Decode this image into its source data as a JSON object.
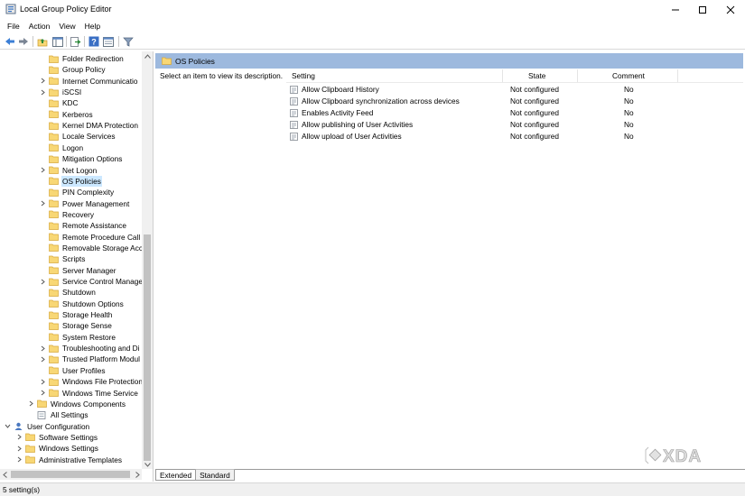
{
  "window": {
    "title": "Local Group Policy Editor",
    "app_icon": "policy-editor-icon",
    "controls": [
      "minimize-icon",
      "maximize-icon",
      "close-icon"
    ]
  },
  "menu": [
    "File",
    "Action",
    "View",
    "Help"
  ],
  "toolbar": {
    "buttons": [
      "back-arrow-icon",
      "forward-arrow-icon",
      "up-folder-icon",
      "show-hide-tree-icon",
      "export-list-icon",
      "help-icon",
      "properties-view-icon",
      "filter-icon"
    ]
  },
  "tree": {
    "items": [
      {
        "label": "Folder Redirection",
        "expandable": false
      },
      {
        "label": "Group Policy",
        "expandable": false
      },
      {
        "label": "Internet Communicatio",
        "expandable": true
      },
      {
        "label": "iSCSI",
        "expandable": true
      },
      {
        "label": "KDC",
        "expandable": false
      },
      {
        "label": "Kerberos",
        "expandable": false
      },
      {
        "label": "Kernel DMA Protection",
        "expandable": false
      },
      {
        "label": "Locale Services",
        "expandable": false
      },
      {
        "label": "Logon",
        "expandable": false
      },
      {
        "label": "Mitigation Options",
        "expandable": false
      },
      {
        "label": "Net Logon",
        "expandable": true
      },
      {
        "label": "OS Policies",
        "expandable": false,
        "selected": true
      },
      {
        "label": "PIN Complexity",
        "expandable": false
      },
      {
        "label": "Power Management",
        "expandable": true
      },
      {
        "label": "Recovery",
        "expandable": false
      },
      {
        "label": "Remote Assistance",
        "expandable": false
      },
      {
        "label": "Remote Procedure Call",
        "expandable": false
      },
      {
        "label": "Removable Storage Acc",
        "expandable": false
      },
      {
        "label": "Scripts",
        "expandable": false
      },
      {
        "label": "Server Manager",
        "expandable": false
      },
      {
        "label": "Service Control Manage",
        "expandable": true
      },
      {
        "label": "Shutdown",
        "expandable": false
      },
      {
        "label": "Shutdown Options",
        "expandable": false
      },
      {
        "label": "Storage Health",
        "expandable": false
      },
      {
        "label": "Storage Sense",
        "expandable": false
      },
      {
        "label": "System Restore",
        "expandable": false
      },
      {
        "label": "Troubleshooting and Di",
        "expandable": true
      },
      {
        "label": "Trusted Platform Modul",
        "expandable": true
      },
      {
        "label": "User Profiles",
        "expandable": false
      },
      {
        "label": "Windows File Protection",
        "expandable": true
      },
      {
        "label": "Windows Time Service",
        "expandable": true
      },
      {
        "label": "Windows Components",
        "expandable": true
      },
      {
        "label": "All Settings",
        "expandable": false
      },
      {
        "label": "User Configuration",
        "expandable": true,
        "expanded": true
      },
      {
        "label": "Software Settings",
        "expandable": true
      },
      {
        "label": "Windows Settings",
        "expandable": true
      },
      {
        "label": "Administrative Templates",
        "expandable": true
      }
    ]
  },
  "right_pane": {
    "folder_title": "OS Policies",
    "description": "Select an item to view its description.",
    "columns": [
      "Setting",
      "State",
      "Comment"
    ],
    "rows": [
      {
        "setting": "Allow Clipboard History",
        "state": "Not configured",
        "comment": "No"
      },
      {
        "setting": "Allow Clipboard synchronization across devices",
        "state": "Not configured",
        "comment": "No"
      },
      {
        "setting": "Enables Activity Feed",
        "state": "Not configured",
        "comment": "No"
      },
      {
        "setting": "Allow publishing of User Activities",
        "state": "Not configured",
        "comment": "No"
      },
      {
        "setting": "Allow upload of User Activities",
        "state": "Not configured",
        "comment": "No"
      }
    ]
  },
  "tabs": [
    "Extended",
    "Standard"
  ],
  "status": "5 setting(s)",
  "watermark": "XDA",
  "colors": {
    "selection": "#cce8ff",
    "header_band": "#9db9de",
    "folder_fill": "#f8d775",
    "folder_edge": "#d7a93b"
  }
}
